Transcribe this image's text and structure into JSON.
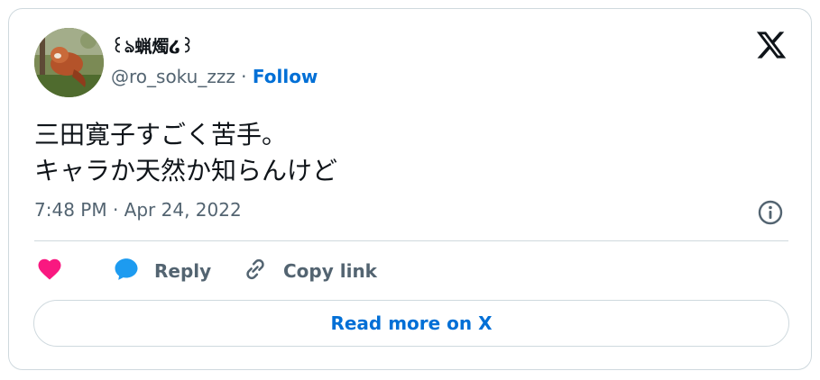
{
  "author": {
    "display_name": "꒰ঌ蝋燭໒꒱",
    "handle": "@ro_soku_zzz",
    "separator": " · ",
    "follow_label": "Follow"
  },
  "tweet": {
    "lines": [
      "三田寛子すごく苦手。",
      "キャラか天然か知らんけど"
    ],
    "timestamp": "7:48 PM · Apr 24, 2022"
  },
  "actions": {
    "reply_label": "Reply",
    "copy_link_label": "Copy link"
  },
  "read_more_label": "Read more on X",
  "colors": {
    "link_blue": "#006fd6",
    "like_pink": "#f91880",
    "reply_blue": "#1d9bf0",
    "secondary_text": "#536471",
    "border": "#cfd9de"
  },
  "icons": {
    "like": "heart-icon",
    "reply": "speech-bubble-icon",
    "copy_link": "link-icon",
    "info": "info-icon",
    "brand": "x-logo-icon"
  }
}
